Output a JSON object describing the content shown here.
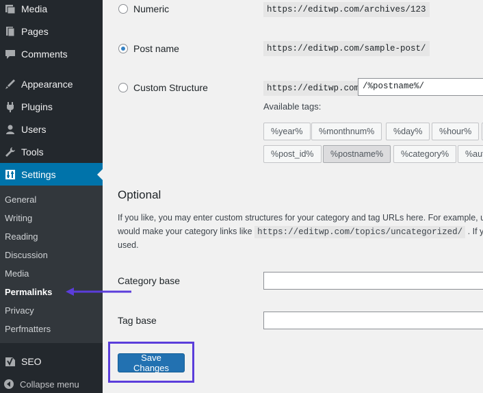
{
  "sidebar": {
    "menu": [
      {
        "label": "Media",
        "icon": "media-icon"
      },
      {
        "label": "Pages",
        "icon": "pages-icon"
      },
      {
        "label": "Comments",
        "icon": "comments-icon"
      },
      {
        "label": "Appearance",
        "icon": "appearance-icon"
      },
      {
        "label": "Plugins",
        "icon": "plugins-icon"
      },
      {
        "label": "Users",
        "icon": "users-icon"
      },
      {
        "label": "Tools",
        "icon": "tools-icon"
      },
      {
        "label": "Settings",
        "icon": "settings-icon"
      }
    ],
    "submenu": [
      "General",
      "Writing",
      "Reading",
      "Discussion",
      "Media",
      "Permalinks",
      "Privacy",
      "Perfmatters"
    ],
    "seo_label": "SEO",
    "collapse_label": "Collapse menu",
    "accent": "#0073aa"
  },
  "permalinks": {
    "options": [
      {
        "label": "Numeric",
        "example": "https://editwp.com/archives/123",
        "checked": false
      },
      {
        "label": "Post name",
        "example": "https://editwp.com/sample-post/",
        "checked": true
      },
      {
        "label": "Custom Structure",
        "example": "https://editwp.com",
        "checked": false
      }
    ],
    "custom_value": "/%postname%/",
    "available_tags_label": "Available tags:",
    "tags_row1": [
      "%year%",
      "%monthnum%",
      "%day%",
      "%hour%"
    ],
    "tags_row2": [
      "%post_id%",
      "%postname%",
      "%category%",
      "%aut"
    ]
  },
  "optional": {
    "heading": "Optional",
    "line1": "If you like, you may enter custom structures for your category and tag URLs here. For example, u",
    "line2_pre": "would make your category links like",
    "line2_code": "https://editwp.com/topics/uncategorized/",
    "line2_post": ". If you l",
    "line3": "used.",
    "category_base_label": "Category base",
    "tag_base_label": "Tag base"
  },
  "save_label": "Save Changes",
  "highlight_color": "#5b3ddb"
}
